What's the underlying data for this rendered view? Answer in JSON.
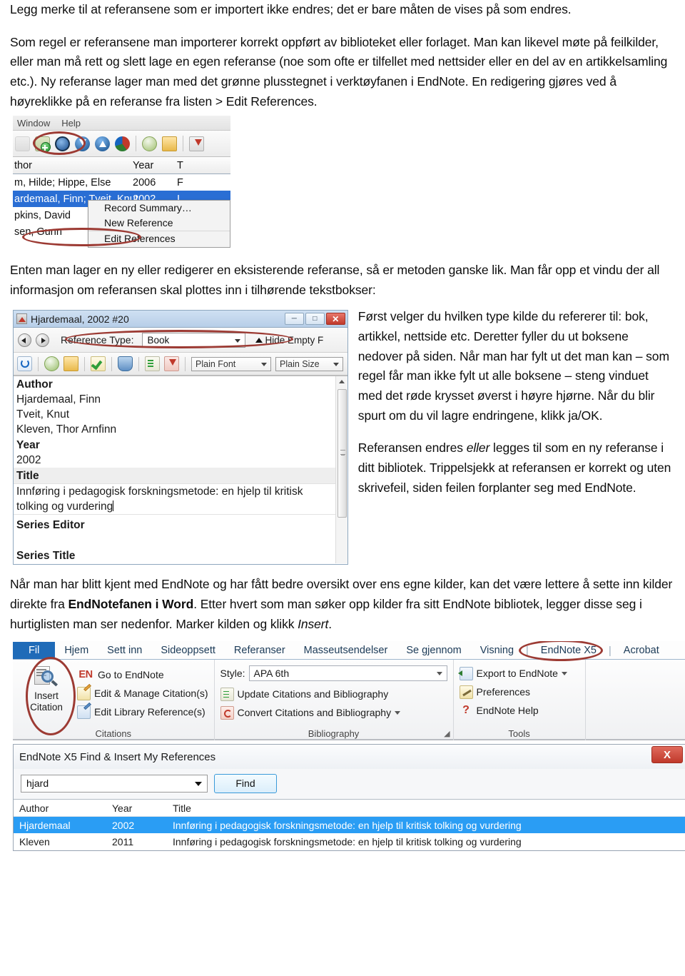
{
  "doc": {
    "para1": "Legg merke til at referansene som er importert ikke endres; det er bare måten de vises på som endres.",
    "para2_a": "Som regel er referansene man importerer korrekt oppført av biblioteket eller forlaget. Man kan likevel møte på feilkilder, eller man må rett og slett lage en egen referanse (noe som ofte er tilfellet med nettsider eller en del av en artikkelsamling etc.). Ny referanse lager man med det grønne plusstegnet i verktøyfanen i EndNote. En redigering gjøres ved å høyreklikke på en referanse fra listen > Edit References.",
    "para3": "Enten man lager en ny eller redigerer en eksisterende referanse, så er metoden ganske lik. Man får opp et vindu der all informasjon om referansen skal plottes inn i tilhørende tekstbokser:",
    "side_para1": "Først velger du hvilken type kilde du refererer til: bok, artikkel, nettside etc. Deretter fyller du ut boksene nedover på siden. Når man har fylt ut det man kan – som regel får man ikke fylt ut alle boksene – steng vinduet med det røde krysset øverst i høyre hjørne. Når du blir spurt om du vil lagre endringene, klikk ja/OK.",
    "side_para2_pre": "Referansen endres ",
    "side_para2_em": "eller",
    "side_para2_post": " legges til som en ny referanse i ditt bibliotek. Trippelsjekk at referansen er korrekt og uten skrivefeil, siden feilen forplanter seg med EndNote.",
    "para4_pre": "Når man har blitt kjent med EndNote og har fått bedre oversikt over ens egne kilder, kan det være lettere å sette inn kilder direkte fra ",
    "para4_bold": "EndNotefanen i Word",
    "para4_mid": ". Etter hvert som man søker opp kilder fra sitt EndNote bibliotek, legger disse seg i hurtiglisten man ser nedenfor. Marker kilden og klikk ",
    "para4_em": "Insert",
    "para4_end": "."
  },
  "shot1": {
    "menu": [
      "Window",
      "Help"
    ],
    "toolbar_icons": [
      "copy-icon",
      "new-reference-icon",
      "search-icon",
      "import-icon",
      "export-icon",
      "online-search-icon",
      "open-link-icon",
      "open-folder-icon",
      "find-full-text-icon"
    ],
    "columns": [
      "thor",
      "Year",
      "T"
    ],
    "rows": [
      {
        "author": "m, Hilde; Hippe, Else",
        "year": "2006",
        "t": "F"
      },
      {
        "author": "ardemaal, Finn; Tveit, Knut;",
        "year": "2002",
        "t": "I"
      },
      {
        "author": "pkins, David",
        "year": "",
        "t": ""
      },
      {
        "author": "sen, Gunn",
        "year": "",
        "t": ""
      }
    ],
    "context_menu": [
      "Record Summary…",
      "New Reference",
      "Edit References"
    ]
  },
  "shot2": {
    "title": "Hjardemaal, 2002 #20",
    "window_buttons": [
      "minimize",
      "maximize",
      "close"
    ],
    "reference_type_label": "Reference Type:",
    "reference_type_value": "Book",
    "hide_empty": "Hide Empty F",
    "toolbar_icons": [
      "refresh-icon",
      "online-search-icon",
      "open-folder-icon",
      "spellcheck-icon",
      "attach-figure-icon",
      "format-icon",
      "find-full-text-icon"
    ],
    "font_combo": "Plain Font",
    "size_combo": "Plain Size",
    "fields": [
      {
        "label": "Author",
        "value": "Hjardemaal, Finn\nTveit, Knut\nKleven, Thor Arnfinn",
        "state": "normal"
      },
      {
        "label": "Year",
        "value": "2002",
        "state": "normal"
      },
      {
        "label": "Title",
        "value": "Innføring i pedagogisk forskningsmetode: en hjelp til kritisk tolking og vurdering",
        "state": "editing"
      },
      {
        "label": "Series Editor",
        "value": "",
        "state": "normal"
      },
      {
        "label": "Series Title",
        "value": "",
        "state": "normal"
      }
    ]
  },
  "shot3": {
    "tabs": [
      "Fil",
      "Hjem",
      "Sett inn",
      "Sideoppsett",
      "Referanser",
      "Masseutsendelser",
      "Se gjennom",
      "Visning",
      "EndNote X5",
      "Acrobat"
    ],
    "citations_group": {
      "name": "Citations",
      "big_button": {
        "line1": "Insert",
        "line2": "Citation",
        "icon": "insert-citation-icon"
      },
      "items": [
        {
          "icon": "en-logo-icon",
          "label": "Go to EndNote"
        },
        {
          "icon": "edit-citation-icon",
          "label": "Edit & Manage Citation(s)"
        },
        {
          "icon": "edit-library-reference-icon",
          "label": "Edit Library Reference(s)"
        }
      ]
    },
    "bibliography_group": {
      "name": "Bibliography",
      "style_label": "Style:",
      "style_value": "APA 6th",
      "items": [
        {
          "icon": "update-citations-icon",
          "label": "Update Citations and Bibliography"
        },
        {
          "icon": "convert-citations-icon",
          "label": "Convert Citations and Bibliography"
        }
      ]
    },
    "tools_group": {
      "name": "Tools",
      "items": [
        {
          "icon": "export-to-endnote-icon",
          "label": "Export to EndNote"
        },
        {
          "icon": "preferences-icon",
          "label": "Preferences"
        },
        {
          "icon": "help-icon",
          "label": "EndNote Help"
        }
      ]
    }
  },
  "shot4": {
    "title": "EndNote X5 Find & Insert My References",
    "close_label": "X",
    "search_value": "hjard",
    "find_button": "Find",
    "columns": [
      "Author",
      "Year",
      "Title"
    ],
    "rows": [
      {
        "author": "Hjardemaal",
        "year": "2002",
        "title": "Innføring i pedagogisk forskningsmetode: en hjelp til kritisk tolking og vurdering",
        "selected": true
      },
      {
        "author": "Kleven",
        "year": "2011",
        "title": "Innføring i pedagogisk forskningsmetode: en hjelp til kritisk tolking og vurdering",
        "selected": false
      }
    ]
  },
  "colors": {
    "annotation_red": "#9c3a33",
    "selection_blue": "#2a9df4",
    "word_blue": "#1f6bb8",
    "close_red": "#c0392b"
  }
}
